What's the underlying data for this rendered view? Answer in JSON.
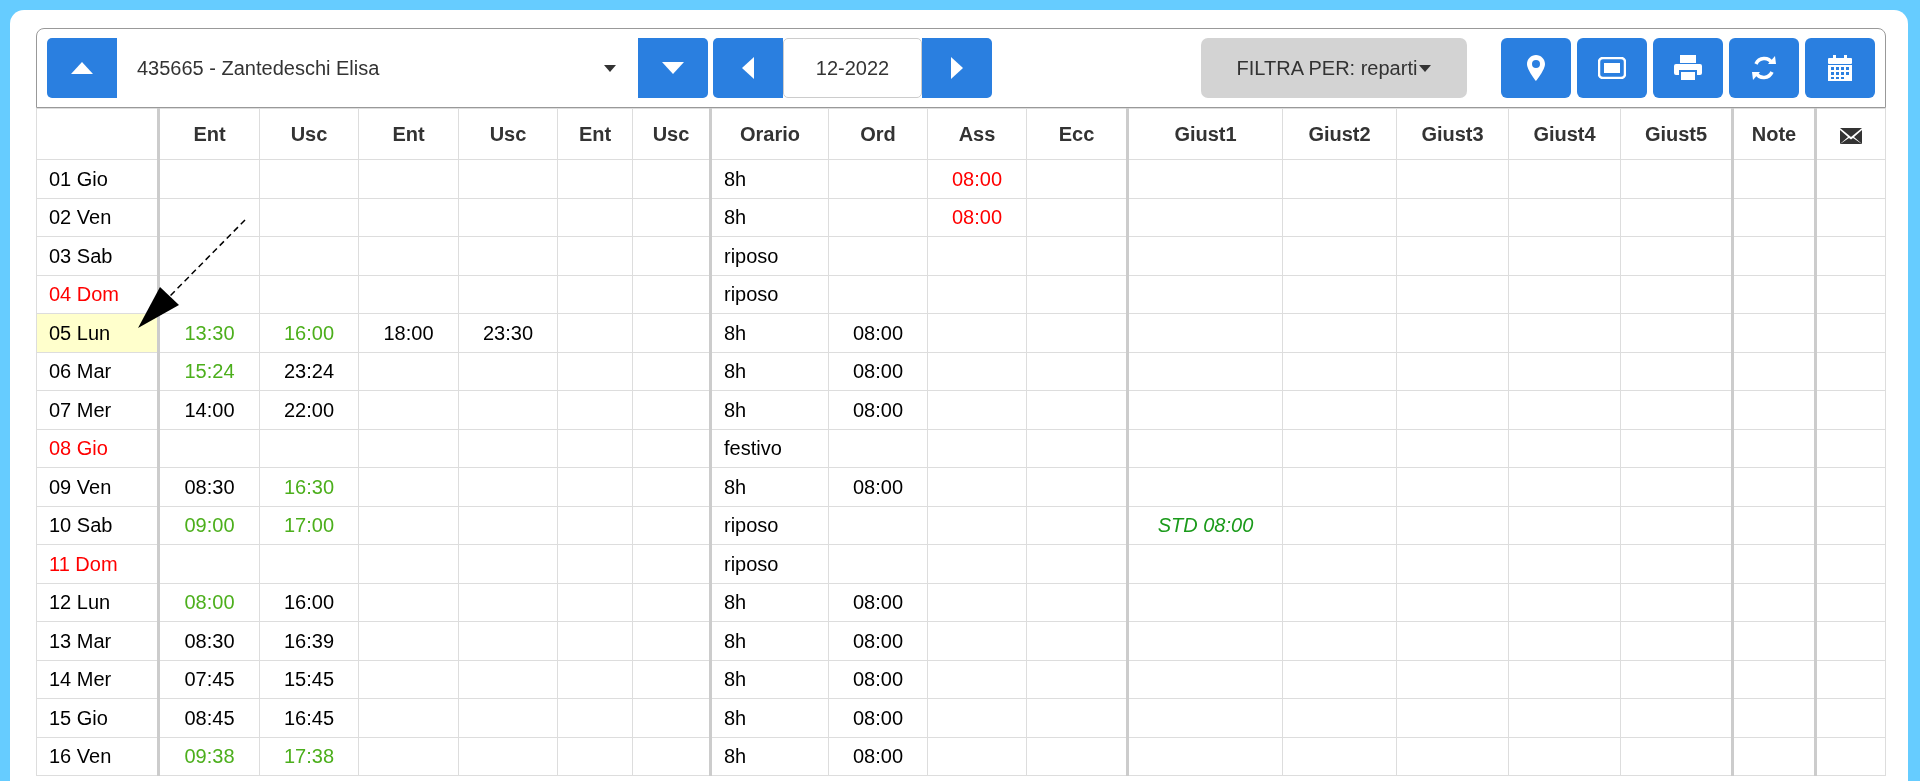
{
  "toolbar": {
    "employee": "435665 - Zantedeschi Elisa",
    "month": "12-2022",
    "filter": "FILTRA PER: reparti"
  },
  "table": {
    "columns": [
      "Ent",
      "Usc",
      "Ent",
      "Usc",
      "Ent",
      "Usc",
      "Orario",
      "Ord",
      "Ass",
      "Ecc",
      "Giust1",
      "Giust2",
      "Giust3",
      "Giust4",
      "Giust5",
      "Note"
    ],
    "rows": [
      {
        "day": "01 Gio",
        "selected": false,
        "cells": [
          null,
          null,
          null,
          null,
          null,
          null,
          "8h",
          null,
          {
            "text": "08:00",
            "color": "#ff0000"
          },
          null,
          null,
          null,
          null,
          null,
          null,
          null
        ]
      },
      {
        "day": "02 Ven",
        "selected": false,
        "cells": [
          null,
          null,
          null,
          null,
          null,
          null,
          "8h",
          null,
          {
            "text": "08:00",
            "color": "#ff0000"
          },
          null,
          null,
          null,
          null,
          null,
          null,
          null
        ]
      },
      {
        "day": "03 Sab",
        "selected": false,
        "cells": [
          null,
          null,
          null,
          null,
          null,
          null,
          "riposo",
          null,
          null,
          null,
          null,
          null,
          null,
          null,
          null,
          null
        ]
      },
      {
        "day": {
          "text": "04 Dom",
          "color": "#ff0000"
        },
        "selected": false,
        "cells": [
          null,
          null,
          null,
          null,
          null,
          null,
          "riposo",
          null,
          null,
          null,
          null,
          null,
          null,
          null,
          null,
          null
        ]
      },
      {
        "day": "05 Lun",
        "selected": true,
        "cells": [
          {
            "text": "13:30",
            "color": "#4caf1c"
          },
          {
            "text": "16:00",
            "color": "#4caf1c"
          },
          "18:00",
          "23:30",
          null,
          null,
          "8h",
          "08:00",
          null,
          null,
          null,
          null,
          null,
          null,
          null,
          null
        ]
      },
      {
        "day": "06 Mar",
        "selected": false,
        "cells": [
          {
            "text": "15:24",
            "color": "#4caf1c"
          },
          "23:24",
          null,
          null,
          null,
          null,
          "8h",
          "08:00",
          null,
          null,
          null,
          null,
          null,
          null,
          null,
          null
        ]
      },
      {
        "day": "07 Mer",
        "selected": false,
        "cells": [
          "14:00",
          "22:00",
          null,
          null,
          null,
          null,
          "8h",
          "08:00",
          null,
          null,
          null,
          null,
          null,
          null,
          null,
          null
        ]
      },
      {
        "day": {
          "text": "08 Gio",
          "color": "#ff0000"
        },
        "selected": false,
        "cells": [
          null,
          null,
          null,
          null,
          null,
          null,
          "festivo",
          null,
          null,
          null,
          null,
          null,
          null,
          null,
          null,
          null
        ]
      },
      {
        "day": "09 Ven",
        "selected": false,
        "cells": [
          "08:30",
          {
            "text": "16:30",
            "color": "#4caf1c"
          },
          null,
          null,
          null,
          null,
          "8h",
          "08:00",
          null,
          null,
          null,
          null,
          null,
          null,
          null,
          null
        ]
      },
      {
        "day": "10 Sab",
        "selected": false,
        "cells": [
          {
            "text": "09:00",
            "color": "#4caf1c"
          },
          {
            "text": "17:00",
            "color": "#4caf1c"
          },
          null,
          null,
          null,
          null,
          "riposo",
          null,
          null,
          null,
          {
            "text": "STD 08:00",
            "color": "#1a9a1a",
            "italic": true
          },
          null,
          null,
          null,
          null,
          null
        ]
      },
      {
        "day": {
          "text": "11 Dom",
          "color": "#ff0000"
        },
        "selected": false,
        "cells": [
          null,
          null,
          null,
          null,
          null,
          null,
          "riposo",
          null,
          null,
          null,
          null,
          null,
          null,
          null,
          null,
          null
        ]
      },
      {
        "day": "12 Lun",
        "selected": false,
        "cells": [
          {
            "text": "08:00",
            "color": "#4caf1c"
          },
          "16:00",
          null,
          null,
          null,
          null,
          "8h",
          "08:00",
          null,
          null,
          null,
          null,
          null,
          null,
          null,
          null
        ]
      },
      {
        "day": "13 Mar",
        "selected": false,
        "cells": [
          "08:30",
          "16:39",
          null,
          null,
          null,
          null,
          "8h",
          "08:00",
          null,
          null,
          null,
          null,
          null,
          null,
          null,
          null
        ]
      },
      {
        "day": "14 Mer",
        "selected": false,
        "cells": [
          "07:45",
          "15:45",
          null,
          null,
          null,
          null,
          "8h",
          "08:00",
          null,
          null,
          null,
          null,
          null,
          null,
          null,
          null
        ]
      },
      {
        "day": "15 Gio",
        "selected": false,
        "cells": [
          "08:45",
          "16:45",
          null,
          null,
          null,
          null,
          "8h",
          "08:00",
          null,
          null,
          null,
          null,
          null,
          null,
          null,
          null
        ]
      },
      {
        "day": "16 Ven",
        "selected": false,
        "cells": [
          {
            "text": "09:38",
            "color": "#4caf1c"
          },
          {
            "text": "17:38",
            "color": "#4caf1c"
          },
          null,
          null,
          null,
          null,
          "8h",
          "08:00",
          null,
          null,
          null,
          null,
          null,
          null,
          null,
          null
        ]
      }
    ]
  }
}
